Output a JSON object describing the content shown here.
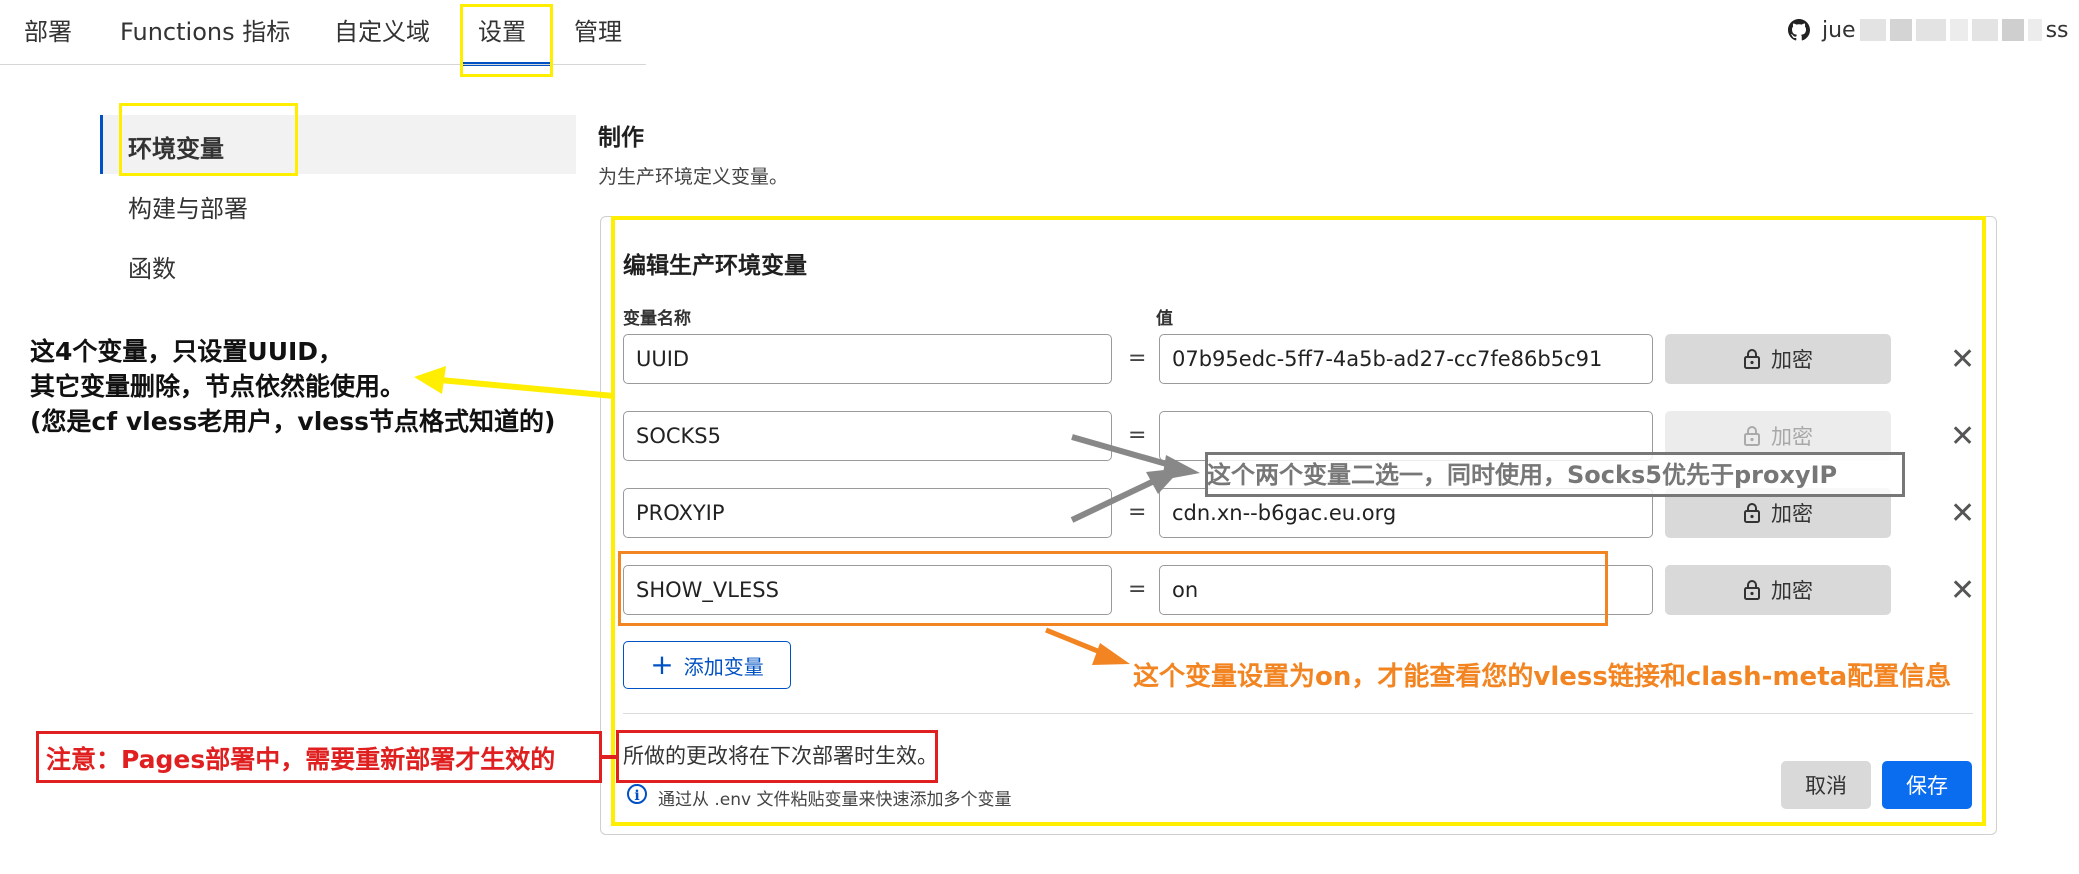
{
  "nav": {
    "tabs": [
      "部署",
      "Functions 指标",
      "自定义域",
      "设置",
      "管理"
    ],
    "active_tab": "设置",
    "user_prefix": "jue",
    "user_suffix": "ss"
  },
  "sidebar": {
    "items": [
      "环境变量",
      "构建与部署",
      "函数"
    ],
    "active": "环境变量"
  },
  "main": {
    "section_title": "制作",
    "section_subtitle": "为生产环境定义变量。",
    "card_title": "编辑生产环境变量",
    "col_name_label": "变量名称",
    "col_value_label": "值",
    "equals": "=",
    "encrypt_label": "加密",
    "delete_glyph": "✕",
    "variables": [
      {
        "name": "UUID",
        "value": "07b95edc-5ff7-4a5b-ad27-cc7fe86b5c91",
        "encrypt_enabled": true
      },
      {
        "name": "SOCKS5",
        "value": "",
        "encrypt_enabled": false
      },
      {
        "name": "PROXYIP",
        "value": "cdn.xn--b6gac.eu.org",
        "encrypt_enabled": true
      },
      {
        "name": "SHOW_VLESS",
        "value": "on",
        "encrypt_enabled": true
      }
    ],
    "add_variable_label": "添加变量",
    "notice": "所做的更改将在下次部署时生效。",
    "hint": "通过从 .env 文件粘贴变量来快速添加多个变量",
    "cancel_label": "取消",
    "save_label": "保存"
  },
  "annotations": {
    "black": [
      "这4个变量，只设置UUID，",
      "其它变量删除，节点依然能使用。",
      "(您是cf vless老用户，vless节点格式知道的)"
    ],
    "gray": "这个两个变量二选一，同时使用，Socks5优先于proxyIP",
    "orange": "这个变量设置为on，才能查看您的vless链接和clash-meta配置信息",
    "red": "注意：Pages部署中，需要重新部署才生效的"
  },
  "colors": {
    "accent": "#0051c3",
    "primary_button": "#0a6df0",
    "annotation_yellow": "#ffee00",
    "annotation_orange": "#f28522",
    "annotation_red": "#e02020",
    "annotation_gray": "#777777"
  }
}
